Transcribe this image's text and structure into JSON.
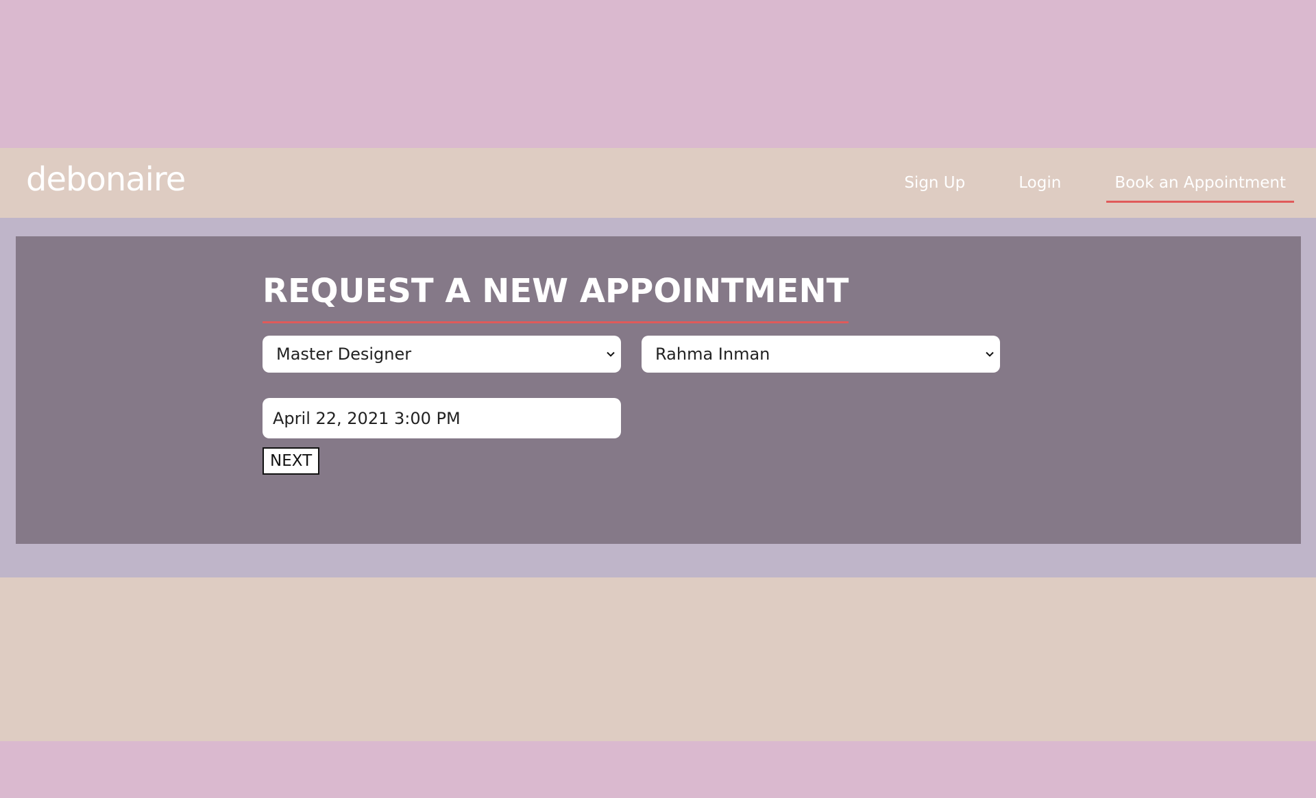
{
  "brand": {
    "name": "debonaire"
  },
  "nav": {
    "items": [
      {
        "label": "Sign Up"
      },
      {
        "label": "Login"
      },
      {
        "label": "Book an Appointment"
      }
    ]
  },
  "form": {
    "title": "REQUEST A NEW APPOINTMENT",
    "service_select": {
      "value": "Master Designer"
    },
    "stylist_select": {
      "value": "Rahma Inman"
    },
    "datetime": {
      "value": "April 22, 2021 3:00 PM"
    },
    "next_label": "NEXT"
  },
  "colors": {
    "accent": "#e05a5a",
    "page_bg": "#dab9cf",
    "nav_bg": "#deccc2",
    "content_bg": "#bfb5c9",
    "panel_bg": "#857988"
  },
  "icons": {
    "select_arrow": "chevron-down-icon"
  }
}
